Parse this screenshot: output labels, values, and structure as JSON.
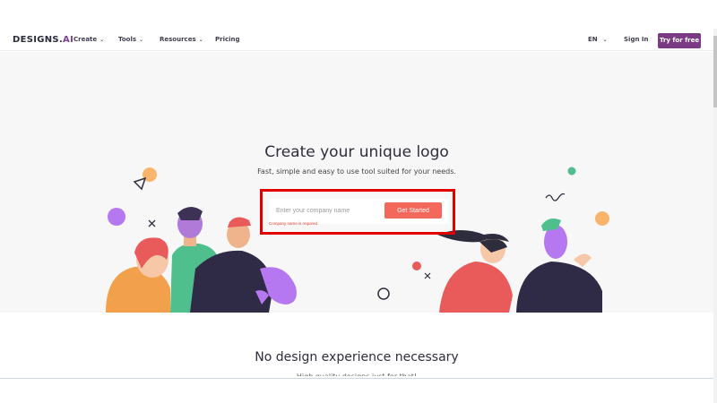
{
  "nav": {
    "logo_text": "DESIGNS.",
    "logo_accent": "AI",
    "items": [
      {
        "label": "Create",
        "icon": "chevron-down-icon"
      },
      {
        "label": "Tools",
        "icon": "chevron-down-icon"
      },
      {
        "label": "Resources",
        "icon": "chevron-down-icon"
      },
      {
        "label": "Pricing"
      }
    ],
    "language": "EN",
    "signin_label": "Sign In",
    "cta_label": "Try for free",
    "cta_color": "#7a3b84"
  },
  "hero": {
    "title": "Create your unique logo",
    "subtitle": "Fast, simple and easy to use tool suited for your needs.",
    "input_placeholder": "Enter your company name",
    "input_value": "",
    "button_label": "Get Started",
    "button_color": "#f2695c",
    "error_text": "Company name is required",
    "highlight_color": "#e10000"
  },
  "section2": {
    "title": "No design experience necessary",
    "subtitle": "High quality designs just for that!"
  }
}
